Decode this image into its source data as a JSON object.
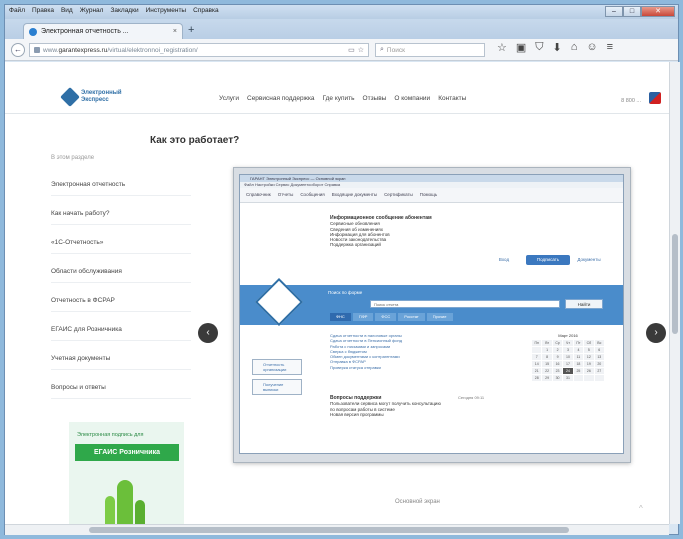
{
  "window": {
    "menu": [
      "Файл",
      "Правка",
      "Вид",
      "Журнал",
      "Закладки",
      "Инструменты",
      "Справка"
    ],
    "min_symbol": "–",
    "max_symbol": "□",
    "close_symbol": "✕"
  },
  "tab": {
    "title": "Электронная отчетность ...",
    "close_symbol": "×",
    "new_tab_symbol": "+"
  },
  "navbar": {
    "back_symbol": "←",
    "url_prefix": "www.",
    "url_host": "garantexpress.ru",
    "url_path": "/virtual/elektronnoi_registration/",
    "reader_symbol": "▭",
    "bookmark_symbol": "☆",
    "search_placeholder": "Поиск",
    "toolbar_icons": [
      "☆",
      "▣",
      "⛉",
      "⬇",
      "⌂",
      "☺",
      "≡"
    ]
  },
  "site": {
    "logo_text": "Электронный Экспресс",
    "nav": [
      "Услуги",
      "Сервисная поддержка",
      "Где купить",
      "Отзывы",
      "О компании",
      "Контакты"
    ],
    "phone": "8 800 ... ",
    "heading": "Как это работает?",
    "sidebar_caption": "В этом разделе",
    "sidebar_items": [
      "Электронная отчетность",
      "Как начать работу?",
      "«1С-Отчетность»",
      "Области обслуживания",
      "Отчетность в ФСРАР",
      "ЕГАИС для Розничника",
      "Учетная документы",
      "Вопросы и ответы"
    ],
    "promo_text": "Электронная подпись для",
    "promo_button": "ЕГАИС Розничника",
    "arrow_left": "‹",
    "arrow_right": "›",
    "shot_caption": "Основной экран",
    "scroll_top": "^"
  },
  "inner_app": {
    "title": "ГАРАНТ Электронный Экспресс  —  Основной экран",
    "menu": "Файл   Настройки   Сервис   Документооборот   Справка",
    "tools": [
      "Справочник",
      "Отчеты",
      "Сообщения",
      "Входящие документы",
      "Сертификаты",
      "Помощь"
    ],
    "info_title": "Информационное сообщение абонентам",
    "info_lines": [
      "Сервисные обновления",
      "Сведения об изменениях",
      "Информация для абонентов",
      "Новости законодательства",
      "Поддержка организаций"
    ],
    "entry_label": "Вход",
    "sign_label": "Подписать",
    "docs_label": "Документы",
    "band_label": "Поиск по форме",
    "band_input": "Поиск отчета",
    "band_find": "Найти",
    "tabs": [
      "ФНС",
      "ПФР",
      "ФСС",
      "Росстат",
      "Прочие"
    ],
    "links": [
      "Сдача отчетности в налоговые органы",
      "Сдача отчетности в Пенсионный фонд",
      "Работа с письмами и запросами",
      "Сверка с бюджетом",
      "Обмен документами с контрагентами",
      "Отправка в ФСРАР",
      "Проверка статуса отправки"
    ],
    "side_btn_1": "Отчетность организации",
    "side_btn_2": "Получение выписки",
    "news_title": "Вопросы поддержки",
    "news_lines": [
      "Пользователи сервиса могут получить консультацию",
      "по вопросам работы в системе",
      "Новая версия программы"
    ],
    "news_date": "Сегодня 09:11",
    "calendar_title": "Март 2016",
    "calendar_days": [
      "Пн",
      "Вт",
      "Ср",
      "Чт",
      "Пт",
      "Сб",
      "Вс",
      "",
      "1",
      "2",
      "3",
      "4",
      "5",
      "6",
      "7",
      "8",
      "9",
      "10",
      "11",
      "12",
      "13",
      "14",
      "15",
      "16",
      "17",
      "18",
      "19",
      "20",
      "21",
      "22",
      "23",
      "24",
      "25",
      "26",
      "27",
      "28",
      "29",
      "30",
      "31",
      "",
      "",
      ""
    ]
  }
}
